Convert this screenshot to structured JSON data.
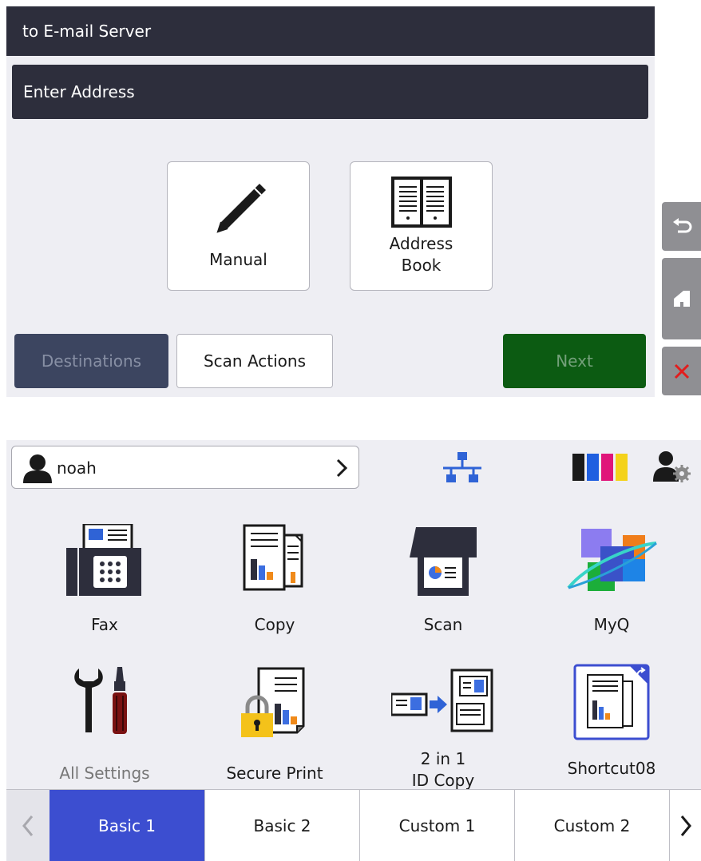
{
  "email_screen": {
    "title": "to E-mail Server",
    "address_label": "Enter Address",
    "options": [
      {
        "label": "Manual",
        "icon": "pencil-icon"
      },
      {
        "label": "Address\nBook",
        "icon": "address-book-icon"
      }
    ],
    "footer": {
      "destinations": "Destinations",
      "scan_actions": "Scan Actions",
      "next": "Next"
    },
    "side_buttons": [
      "back-icon",
      "home-icon",
      "close-icon"
    ]
  },
  "home_screen": {
    "user": "noah",
    "status_icons": [
      "network-icon",
      "toner-icon",
      "admin-settings-icon"
    ],
    "tiles": [
      {
        "label": "Fax",
        "icon": "fax-icon",
        "enabled": true
      },
      {
        "label": "Copy",
        "icon": "copy-icon",
        "enabled": true
      },
      {
        "label": "Scan",
        "icon": "scan-icon",
        "enabled": true
      },
      {
        "label": "MyQ",
        "icon": "myq-icon",
        "enabled": true
      },
      {
        "label": "All Settings",
        "icon": "settings-tools-icon",
        "enabled": false
      },
      {
        "label": "Secure Print",
        "icon": "secure-print-icon",
        "enabled": true
      },
      {
        "label": "2 in 1\nID Copy",
        "icon": "id-copy-icon",
        "enabled": true
      },
      {
        "label": "Shortcut08",
        "icon": "shortcut-icon",
        "enabled": true
      }
    ],
    "tabs": [
      {
        "label": "Basic 1",
        "selected": true
      },
      {
        "label": "Basic 2",
        "selected": false
      },
      {
        "label": "Custom 1",
        "selected": false
      },
      {
        "label": "Custom 2",
        "selected": false
      }
    ]
  },
  "colors": {
    "header_bg": "#2d2e3c",
    "panel_bg": "#eeeef3",
    "next_green": "#0c5b12",
    "destinations_bg": "#3c4560",
    "tab_selected": "#3c4ed0",
    "toner": [
      "#1a1a1a",
      "#1f5fe0",
      "#e0157a",
      "#f4d21a"
    ]
  }
}
